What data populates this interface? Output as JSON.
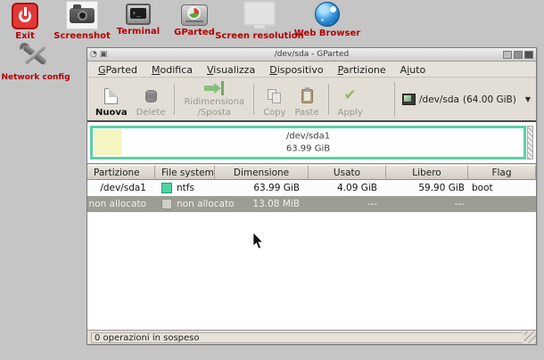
{
  "desktop": {
    "icons": [
      {
        "label": "Exit"
      },
      {
        "label": "Screenshot"
      },
      {
        "label": "Terminal"
      },
      {
        "label": "GParted"
      },
      {
        "label": "Screen resolution"
      },
      {
        "label": "Web Browser"
      },
      {
        "label": "Network config"
      }
    ],
    "label_color": "#b40000",
    "background_color": "#c5c5c5"
  },
  "window": {
    "title": "/dev/sda - GParted",
    "menu": {
      "items": [
        {
          "pre": "",
          "m": "G",
          "rest": "Parted"
        },
        {
          "pre": "",
          "m": "M",
          "rest": "odifica"
        },
        {
          "pre": "",
          "m": "V",
          "rest": "isualizza"
        },
        {
          "pre": "",
          "m": "D",
          "rest": "ispositivo"
        },
        {
          "pre": "",
          "m": "P",
          "rest": "artizione"
        },
        {
          "pre": "A",
          "m": "i",
          "rest": "uto"
        }
      ]
    },
    "toolbar": {
      "new_label": "Nuova",
      "delete_label": "Delete",
      "resize_label_line1": "Ridimensiona",
      "resize_label_line2": "/Sposta",
      "copy_label": "Copy",
      "paste_label": "Paste",
      "apply_label": "Apply",
      "device_name": "/dev/sda",
      "device_size": "(64.00 GiB)",
      "device_dropdown_arrow": "▼"
    },
    "visual_bar": {
      "partition_label": "/dev/sda1",
      "partition_size": "63.99 GiB",
      "border_color": "#5bd0a4",
      "used_color": "#f5f5bf"
    },
    "table": {
      "headers": [
        "Partizione",
        "File system",
        "Dimensione",
        "Usato",
        "Libero",
        "Flag"
      ],
      "rows": [
        {
          "partition": "/dev/sda1",
          "filesystem": "ntfs",
          "fs_color": "#52d0a0",
          "size": "63.99 GiB",
          "used": "4.09 GiB",
          "free": "59.90 GiB",
          "flags": "boot",
          "selected": false
        },
        {
          "partition": "non allocato",
          "filesystem": "non allocato",
          "fs_color": "#cfcfc9",
          "size": "13.08 MiB",
          "used": "---",
          "free": "---",
          "flags": "",
          "selected": true
        }
      ]
    },
    "statusbar": {
      "text": "0 operazioni in sospeso"
    }
  }
}
